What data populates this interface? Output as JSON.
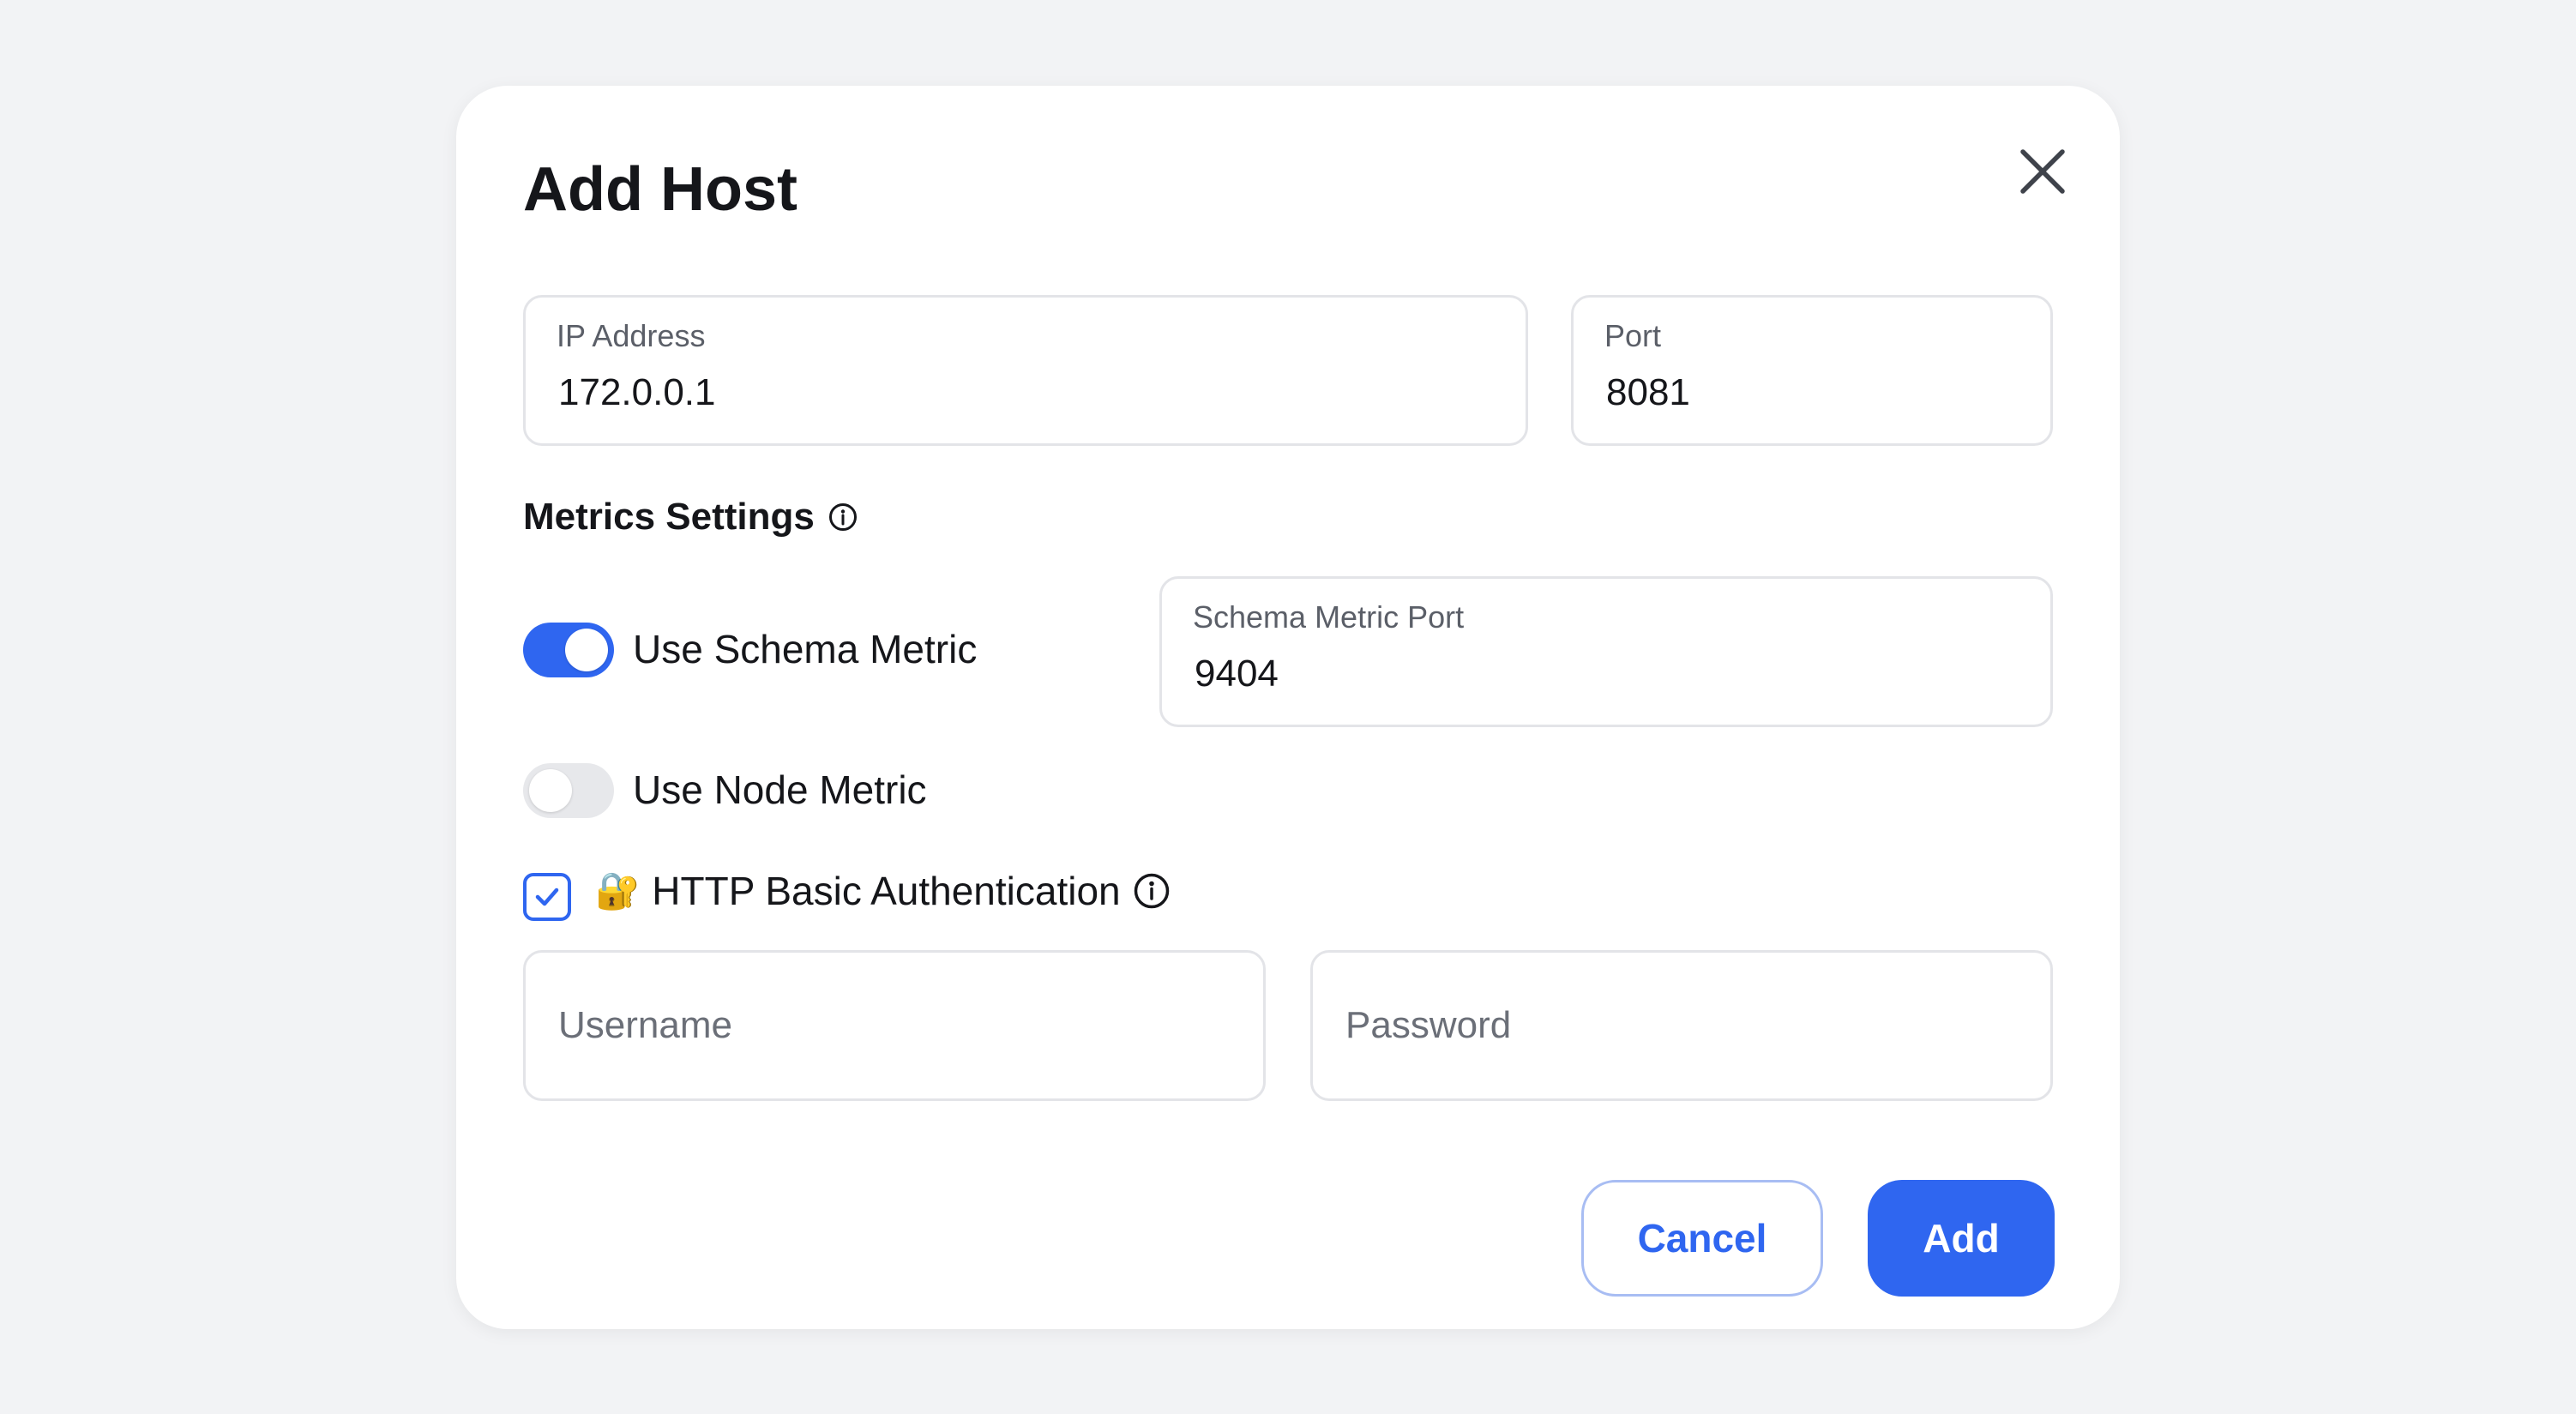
{
  "dialog": {
    "title": "Add Host",
    "close_icon": "close-icon"
  },
  "fields": {
    "ip_address": {
      "label": "IP Address",
      "value": "172.0.0.1"
    },
    "port": {
      "label": "Port",
      "value": "8081"
    },
    "schema_metric_port": {
      "label": "Schema Metric Port",
      "value": "9404"
    },
    "username": {
      "placeholder": "Username",
      "value": ""
    },
    "password": {
      "placeholder": "Password",
      "value": ""
    }
  },
  "metrics": {
    "heading": "Metrics Settings",
    "info_icon": "info-icon",
    "use_schema_metric": {
      "label": "Use Schema Metric",
      "checked": true
    },
    "use_node_metric": {
      "label": "Use Node Metric",
      "checked": false
    }
  },
  "auth": {
    "label": "HTTP Basic Authentication",
    "emoji": "🔐",
    "checked": true,
    "info_icon": "info-icon"
  },
  "actions": {
    "cancel_label": "Cancel",
    "add_label": "Add"
  },
  "colors": {
    "accent": "#2f66f0",
    "background": "#f2f3f5",
    "surface": "#ffffff",
    "text": "#15161a",
    "muted_text": "#5b5f68",
    "border": "#e3e4e8",
    "toggle_off": "#e7e8eb"
  }
}
